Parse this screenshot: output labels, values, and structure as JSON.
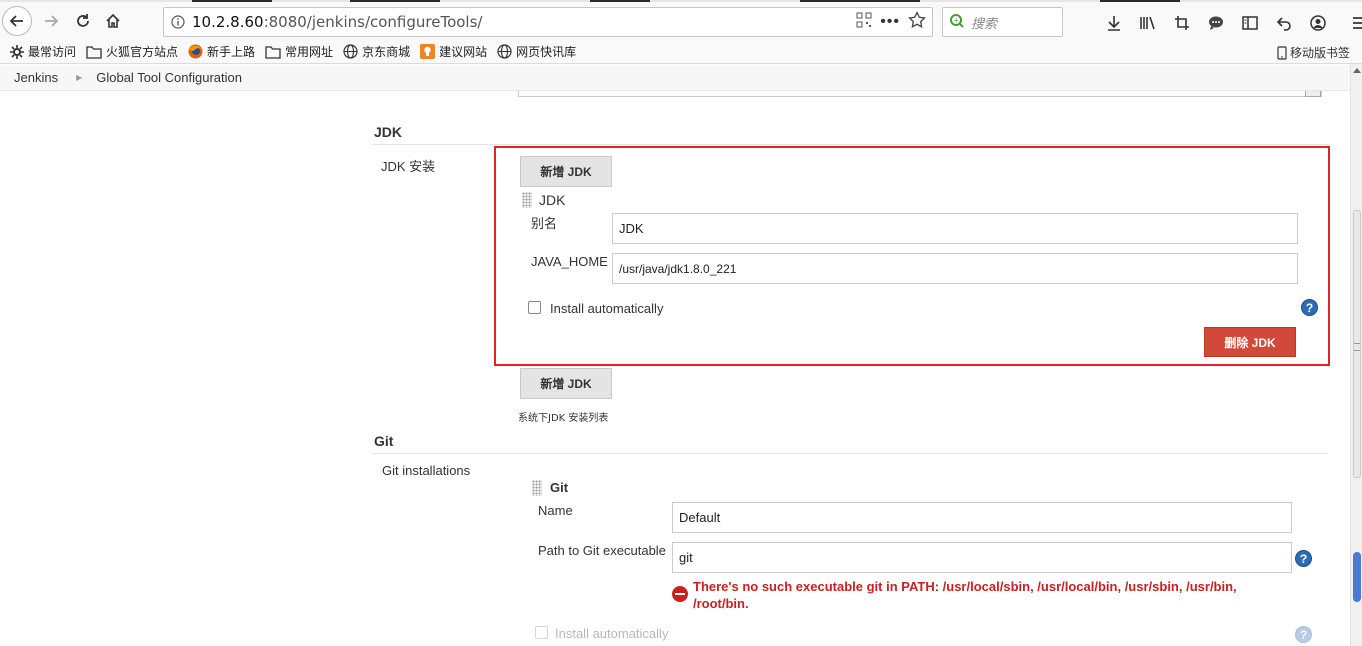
{
  "browser": {
    "url_host": "10.2.8.60",
    "url_rest": ":8080/jenkins/configureTools/",
    "search_placeholder": "搜索"
  },
  "bookmarks": [
    {
      "label": "最常访问",
      "icon": "gear-icon"
    },
    {
      "label": "火狐官方站点",
      "icon": "folder-icon"
    },
    {
      "label": "新手上路",
      "icon": "firefox-icon"
    },
    {
      "label": "常用网址",
      "icon": "folder-icon"
    },
    {
      "label": "京东商城",
      "icon": "globe-icon"
    },
    {
      "label": "建议网站",
      "icon": "bulb-icon"
    },
    {
      "label": "网页快讯库",
      "icon": "globe-icon"
    }
  ],
  "bookmarks_mobile": "移动版书签",
  "breadcrumb": {
    "root": "Jenkins",
    "current": "Global Tool Configuration"
  },
  "jdk": {
    "section_title": "JDK",
    "row_label": "JDK 安装",
    "add_button": "新增 JDK",
    "item_title": "JDK",
    "alias_label": "别名",
    "alias_value": "JDK",
    "java_home_label": "JAVA_HOME",
    "java_home_value": "/usr/java/jdk1.8.0_221",
    "install_auto_label": "Install automatically",
    "delete_button": "删除 JDK",
    "add_button_bottom": "新增 JDK",
    "note": "系统下JDK 安装列表"
  },
  "git": {
    "section_title": "Git",
    "row_label": "Git installations",
    "item_title": "Git",
    "name_label": "Name",
    "name_value": "Default",
    "path_label": "Path to Git executable",
    "path_value": "git",
    "error": "There's no such executable git in PATH: /usr/local/sbin, /usr/local/bin, /usr/sbin, /usr/bin, /root/bin.",
    "install_auto_label": "Install automatically"
  },
  "colors": {
    "highlight_border": "#e02424",
    "delete_button": "#d24939",
    "error_text": "#cc1f1f",
    "help_icon": "#2d6db5"
  }
}
